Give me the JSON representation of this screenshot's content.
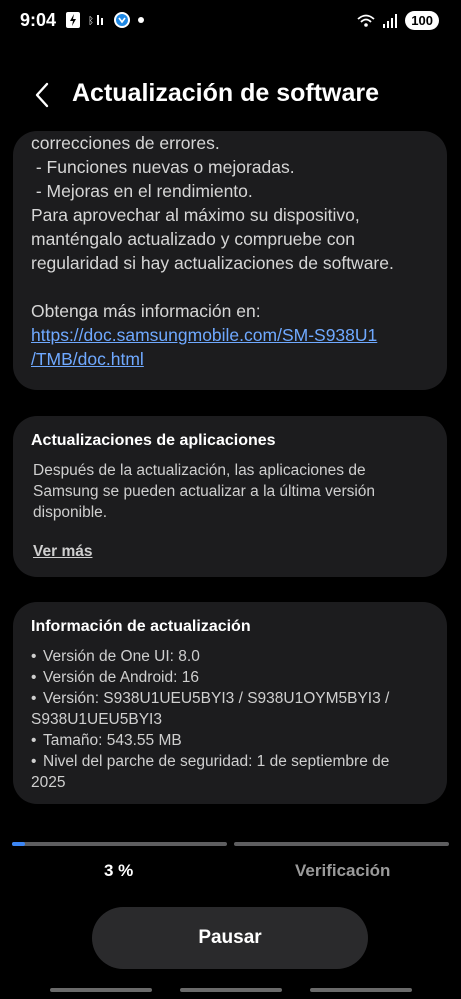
{
  "status_bar": {
    "time": "9:04",
    "battery": "100",
    "icons_left": [
      "flash-icon",
      "network-icon",
      "app-icon",
      "dot-icon"
    ],
    "icons_right": [
      "wifi-icon",
      "signal-icon"
    ]
  },
  "header": {
    "title": "Actualización de software"
  },
  "release_notes": {
    "lines": [
      "correcciones de errores.",
      " - Funciones nuevas o mejoradas.",
      " - Mejoras en el rendimiento.",
      "Para aprovechar al máximo su dispositivo,",
      "manténgalo actualizado y compruebe con",
      "regularidad si hay actualizaciones de software."
    ],
    "more_info_label": "Obtenga más información en:",
    "link_line1": "https://doc.samsungmobile.com/SM-S938U1",
    "link_line2": "/TMB/doc.html"
  },
  "app_updates": {
    "title": "Actualizaciones de aplicaciones",
    "desc_lines": [
      "Después de la actualización, las aplicaciones de",
      "Samsung se pueden actualizar a la última versión",
      "disponible."
    ],
    "see_more": "Ver más"
  },
  "update_info": {
    "title": "Información de actualización",
    "lines": [
      "Versión de One UI: 8.0",
      "Versión de Android: 16",
      "Versión: S938U1UEU5BYI3 / S938U1OYM5BYI3 /",
      "S938U1UEU5BYI3",
      "Tamaño: 543.55 MB",
      "Nivel del parche de seguridad: 1 de septiembre de",
      "2025"
    ]
  },
  "progress": {
    "percent_label": "3 %",
    "percent": 3,
    "step_label": "Verificación"
  },
  "pause_button": "Pausar",
  "colors": {
    "accent": "#3c86f5",
    "link": "#6fa9ff",
    "card_bg": "#1c1c1e",
    "background": "#000000"
  }
}
